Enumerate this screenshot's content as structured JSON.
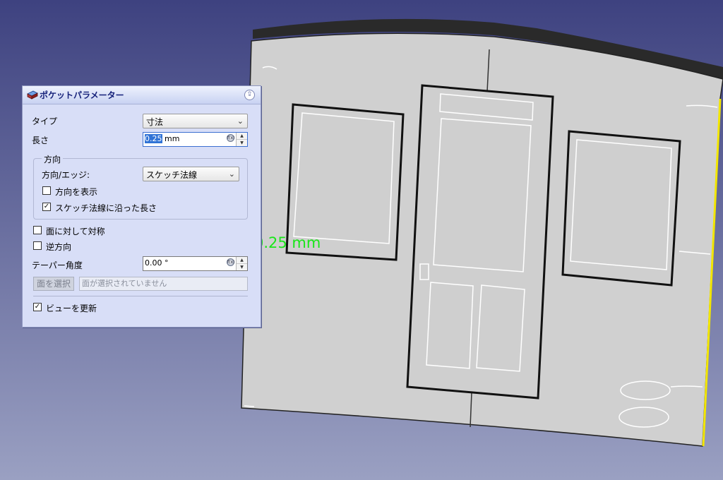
{
  "viewport": {
    "background_top": "#3e4280",
    "background_bottom": "#9aa0c2",
    "dimension_text": "0.25 mm",
    "dimension_color": "#19e619"
  },
  "panel": {
    "title": "ポケットパラメーター",
    "icon": "pocket-icon",
    "collapse_icon": "double-chevron-up-icon",
    "type_label": "タイプ",
    "type_value": "寸法",
    "length_label": "長さ",
    "length_selected": "0.25",
    "length_unit": " mm",
    "direction_group": "方向",
    "direction_edge_label": "方向/エッジ:",
    "direction_edge_value": "スケッチ法線",
    "show_direction_label": "方向を表示",
    "show_direction_checked": false,
    "along_normal_label": "スケッチ法線に沿った長さ",
    "along_normal_checked": true,
    "symmetric_label": "面に対して対称",
    "symmetric_checked": false,
    "reversed_label": "逆方向",
    "reversed_checked": false,
    "taper_label": "テーパー角度",
    "taper_value": "0.00 °",
    "select_face_label": "面を選択",
    "face_field_text": "面が選択されていません",
    "update_view_label": "ビューを更新",
    "update_view_checked": true
  }
}
